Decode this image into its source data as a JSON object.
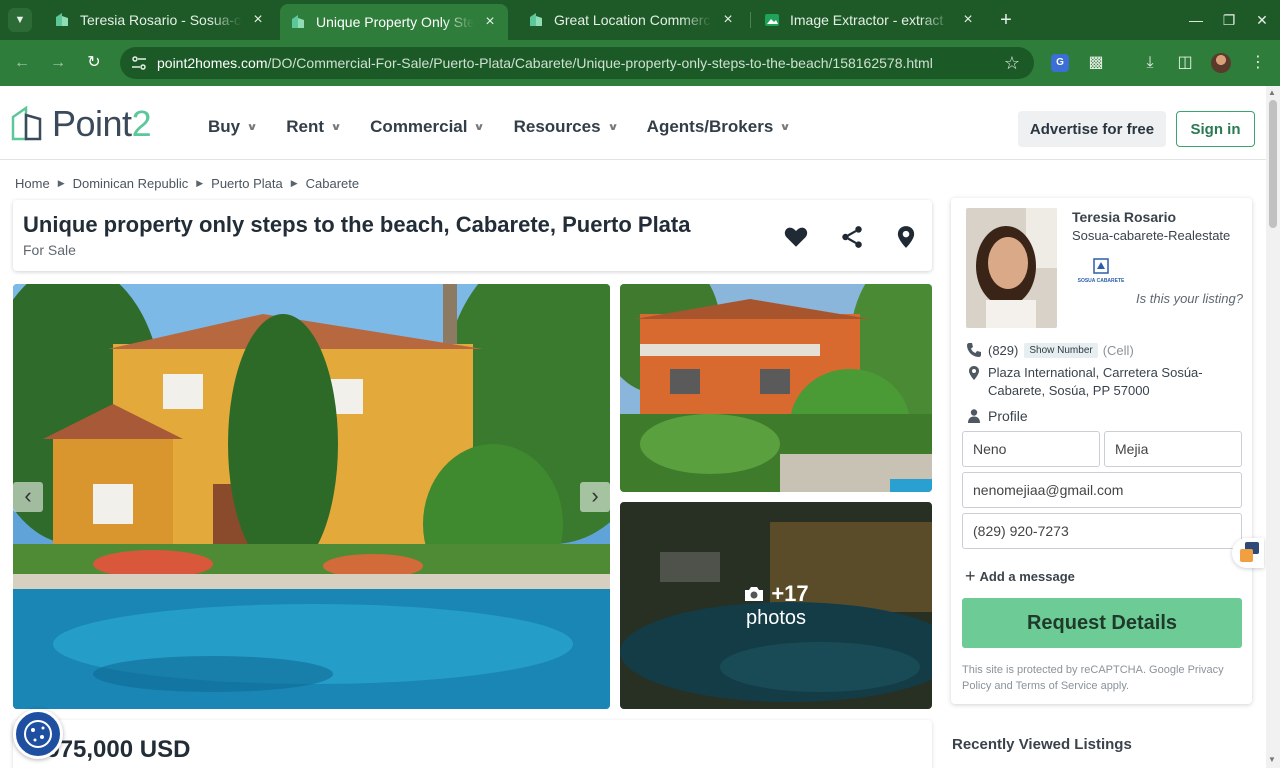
{
  "browser": {
    "tabs": [
      {
        "title": "Teresia Rosario - Sosua-cabarete-Realestate",
        "active": false
      },
      {
        "title": "Unique Property Only Steps to the Beach",
        "active": true
      },
      {
        "title": "Great Location Commercial",
        "active": false
      },
      {
        "title": "Image Extractor - extract",
        "active": false
      }
    ],
    "url_host": "point2homes.com",
    "url_path": "/DO/Commercial-For-Sale/Puerto-Plata/Cabarete/Unique-property-only-steps-to-the-beach/158162578.html",
    "colors": {
      "tabbar": "#1e5a28",
      "toolbar": "#2e7d3a"
    }
  },
  "header": {
    "logo_main": "Point",
    "logo_accent": "2",
    "menu": [
      {
        "label": "Buy"
      },
      {
        "label": "Rent"
      },
      {
        "label": "Commercial"
      },
      {
        "label": "Resources"
      },
      {
        "label": "Agents/Brokers"
      }
    ],
    "advertise_label": "Advertise for free",
    "signin_label": "Sign in"
  },
  "breadcrumb": [
    "Home",
    "Dominican Republic",
    "Puerto Plata",
    "Cabarete"
  ],
  "listing": {
    "title": "Unique property only steps to the beach, Cabarete, Puerto Plata",
    "status": "For Sale",
    "more_photos_count": "+17",
    "more_photos_label": "photos",
    "price": "$975,000 USD"
  },
  "agent": {
    "name": "Teresia Rosario",
    "company": "Sosua-cabarete-Realestate",
    "logo_text": "SOSUA CABARETE",
    "is_your_listing": "Is this your listing?",
    "phone_prefix": "(829)",
    "show_number_label": "Show Number",
    "phone_type": "(Cell)",
    "address": "Plaza International, Carretera Sosúa-Cabarete, Sosúa, PP 57000",
    "profile_label": "Profile"
  },
  "form": {
    "first_name": "Neno",
    "last_name": "Mejia",
    "email": "nenomejiaa@gmail.com",
    "phone": "(829) 920-7273",
    "add_message_label": "Add a message",
    "request_label": "Request Details",
    "recaptcha_text": "This site is protected by reCAPTCHA. Google Privacy Policy and Terms of Service apply."
  },
  "recently_viewed_title": "Recently Viewed Listings"
}
